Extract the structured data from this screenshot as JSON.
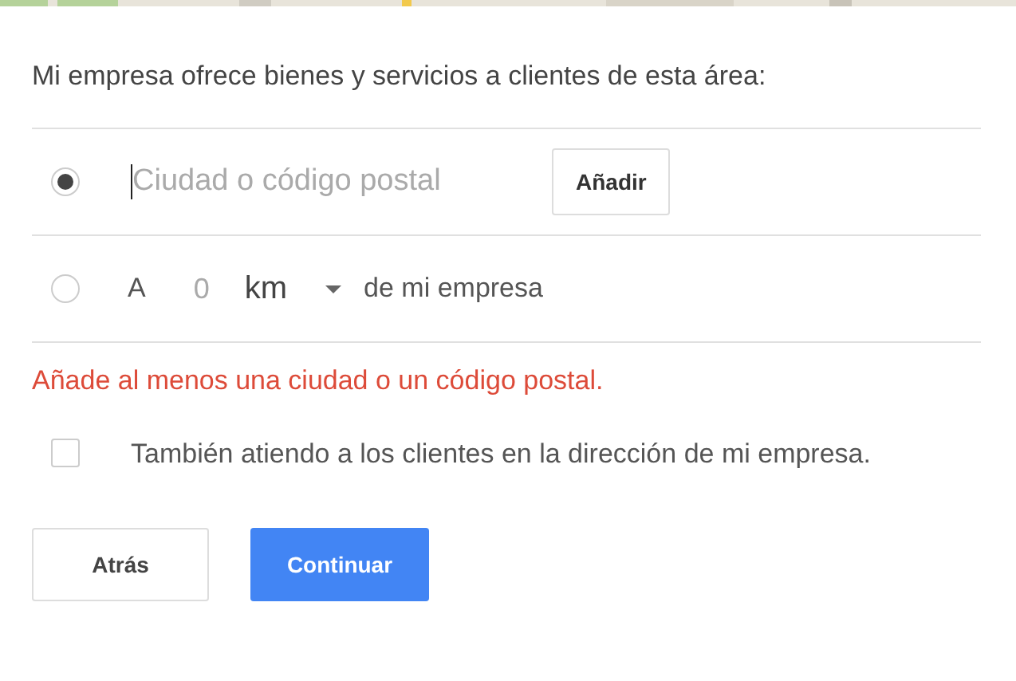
{
  "heading": "Mi empresa ofrece bienes y servicios a clientes de esta área:",
  "options": [
    {
      "kind": "city",
      "selected": true,
      "field": {
        "placeholder": "Ciudad o código postal",
        "focused": true
      },
      "button": "Añadir"
    },
    {
      "kind": "radius",
      "selected": false,
      "prefix": "A",
      "value": "0",
      "unit": "km",
      "suffix": "de mi empresa"
    }
  ],
  "error": "Añade al menos una ciudad o un código postal.",
  "checkbox": {
    "label": "También atiendo a los clientes en la dirección de mi empresa.",
    "checked": false
  },
  "buttons": [
    {
      "label": "Atrás",
      "kind": "secondary"
    },
    {
      "label": "Continuar",
      "kind": "primary"
    }
  ]
}
